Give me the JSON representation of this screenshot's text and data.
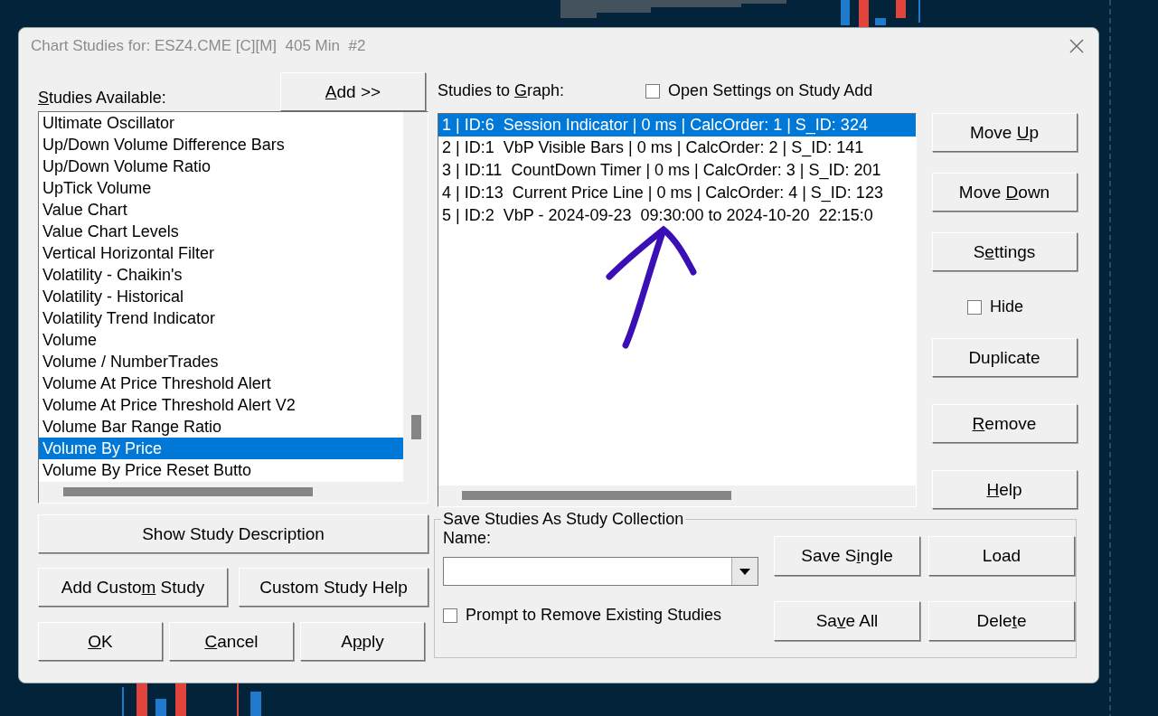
{
  "window": {
    "title": "Chart Studies for: ESZ4.CME [C][M]  405 Min  #2"
  },
  "available": {
    "label": {
      "key": "S",
      "after": "tudies Available:"
    },
    "add_button": {
      "key": "A",
      "after": "dd >>"
    },
    "items": [
      {
        "text": "Ultimate Oscillator",
        "selected": false
      },
      {
        "text": "Up/Down Volume Difference Bars",
        "selected": false
      },
      {
        "text": "Up/Down Volume Ratio",
        "selected": false
      },
      {
        "text": "UpTick Volume",
        "selected": false
      },
      {
        "text": "Value Chart",
        "selected": false
      },
      {
        "text": "Value Chart Levels",
        "selected": false
      },
      {
        "text": "Vertical Horizontal Filter",
        "selected": false
      },
      {
        "text": "Volatility - Chaikin's",
        "selected": false
      },
      {
        "text": "Volatility - Historical",
        "selected": false
      },
      {
        "text": "Volatility Trend Indicator",
        "selected": false
      },
      {
        "text": "Volume",
        "selected": false
      },
      {
        "text": "Volume / NumberTrades",
        "selected": false
      },
      {
        "text": "Volume At Price Threshold Alert",
        "selected": false
      },
      {
        "text": "Volume At Price Threshold Alert V2",
        "selected": false
      },
      {
        "text": "Volume Bar Range Ratio",
        "selected": false
      },
      {
        "text": "Volume By Price",
        "selected": true
      },
      {
        "text": "Volume By Price Reset Butto",
        "selected": false
      }
    ]
  },
  "graph": {
    "label": {
      "before": "Studies to ",
      "key": "G",
      "after": "raph:"
    },
    "open_settings": {
      "label": "Open Settings on Study Add",
      "checked": false
    },
    "items": [
      {
        "text": "1 | ID:6  Session Indicator | 0 ms | CalcOrder: 1 | S_ID: 324",
        "selected": true
      },
      {
        "text": "2 | ID:1  VbP Visible Bars | 0 ms | CalcOrder: 2 | S_ID: 141",
        "selected": false
      },
      {
        "text": "3 | ID:11  CountDown Timer | 0 ms | CalcOrder: 3 | S_ID: 201",
        "selected": false
      },
      {
        "text": "4 | ID:13  Current Price Line | 0 ms | CalcOrder: 4 | S_ID: 123",
        "selected": false
      },
      {
        "text": "5 | ID:2  VbP - 2024-09-23  09:30:00 to 2024-10-20  22:15:0",
        "selected": false
      }
    ]
  },
  "side_buttons": [
    {
      "kind": "button",
      "label": {
        "before": "Move ",
        "key": "U",
        "after": "p"
      }
    },
    {
      "kind": "button",
      "label": {
        "before": "Move ",
        "key": "D",
        "after": "own"
      }
    },
    {
      "kind": "button",
      "label": {
        "before": "S",
        "key": "e",
        "after": "ttings"
      }
    },
    {
      "kind": "checkbox",
      "label": "Hide",
      "checked": false
    },
    {
      "kind": "button",
      "label": "Duplicate"
    },
    {
      "kind": "button",
      "label": {
        "key": "R",
        "after": "emove"
      }
    },
    {
      "kind": "button",
      "label": {
        "key": "H",
        "after": "elp"
      }
    }
  ],
  "left_buttons": {
    "description": "Show Study Description",
    "custom": {
      "before": "Add Custo",
      "key": "m",
      "after": " Study"
    },
    "custom_help": "Custom Study Help"
  },
  "dialog_buttons": [
    {
      "key": "O",
      "after": "K"
    },
    {
      "key": "C",
      "after": "ancel"
    },
    {
      "before": "A",
      "key": "p",
      "after": "ply"
    }
  ],
  "collection": {
    "title": "Save Studies As Study Collection",
    "name_label": "Name:",
    "prompt": {
      "label": "Prompt to Remove Existing Studies",
      "checked": false
    },
    "buttons": [
      {
        "before": "Save S",
        "key": "i",
        "after": "ngle"
      },
      "Load",
      {
        "before": "Sa",
        "key": "v",
        "after": "e All"
      },
      {
        "before": "Dele",
        "key": "t",
        "after": "e"
      }
    ]
  }
}
